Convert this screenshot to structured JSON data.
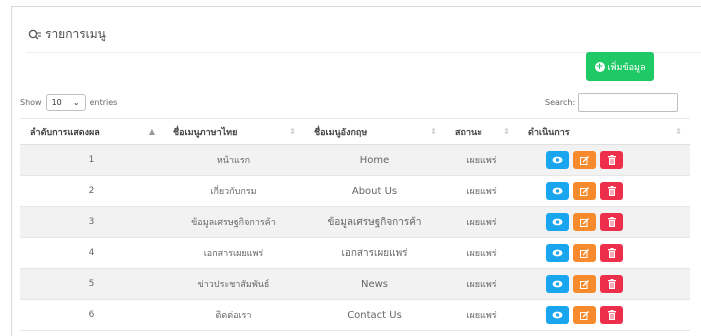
{
  "header": {
    "title": "รายการเมนู",
    "icon": "search-list-icon"
  },
  "add_button": {
    "label": "เพิ่มข้อมูล",
    "icon": "plus-circle-icon"
  },
  "length": {
    "show_label": "Show",
    "value": "10",
    "entries_label": "entries"
  },
  "search": {
    "label": "Search:",
    "value": ""
  },
  "table": {
    "columns": [
      "ลำดับการแสดงผล",
      "ชื่อเมนูภาษาไทย",
      "ชื่อเมนูอังกฤษ",
      "สถานะ",
      "ดำเนินการ"
    ],
    "sorted_column": 0,
    "rows": [
      {
        "order": "1",
        "th": "หน้าแรก",
        "en": "Home",
        "status": "เผยแพร่"
      },
      {
        "order": "2",
        "th": "เกี่ยวกับกรม",
        "en": "About Us",
        "status": "เผยแพร่"
      },
      {
        "order": "3",
        "th": "ข้อมูลเศรษฐกิจการค้า",
        "en": "ข้อมูลเศรษฐกิจการค้า",
        "status": "เผยแพร่"
      },
      {
        "order": "4",
        "th": "เอกสารเผยแพร่",
        "en": "เอกสารเผยแพร่",
        "status": "เผยแพร่"
      },
      {
        "order": "5",
        "th": "ข่าวประชาสัมพันธ์",
        "en": "News",
        "status": "เผยแพร่"
      },
      {
        "order": "6",
        "th": "ติดต่อเรา",
        "en": "Contact Us",
        "status": "เผยแพร่"
      }
    ]
  },
  "colors": {
    "add": "#1ec966",
    "view": "#1aa6ee",
    "edit": "#f78a2d",
    "delete": "#ed2f4b"
  }
}
